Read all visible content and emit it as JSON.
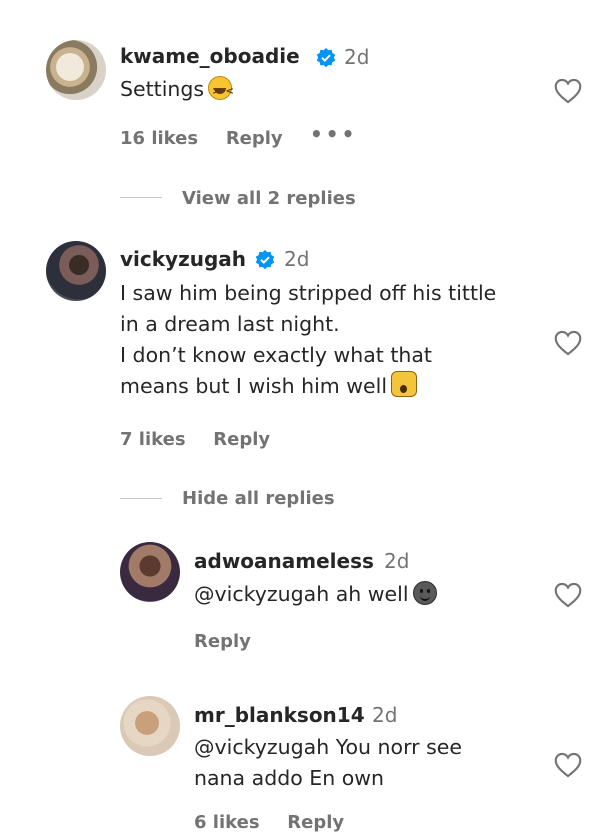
{
  "colors": {
    "text": "#262626",
    "secondary": "#737373",
    "verified": "#0095f6"
  },
  "comments": [
    {
      "username": "kwame_oboadie",
      "verified": true,
      "time": "2d",
      "text": "Settings",
      "emoji": "laughing-emoji",
      "likes": "16 likes",
      "reply": "Reply",
      "more": "•••",
      "thread_toggle": "View all 2 replies"
    },
    {
      "username": "vickyzugah",
      "verified": true,
      "time": "2d",
      "lines": [
        "I saw him being stripped off his tittle",
        "in a dream last night.",
        "I don’t know exactly what that",
        "means but I wish him well"
      ],
      "emoji": "face-screaming-emoji",
      "likes": "7 likes",
      "reply": "Reply",
      "thread_toggle": "Hide all replies",
      "replies": [
        {
          "username": "adwoanameless",
          "time": "2d",
          "text": "@vickyzugah ah well",
          "emoji": "dark-face-emoji",
          "reply": "Reply"
        },
        {
          "username": "mr_blankson14",
          "time": "2d",
          "lines": [
            "@vickyzugah You norr see",
            "nana addo En own"
          ],
          "likes": "6 likes",
          "reply": "Reply"
        }
      ]
    }
  ]
}
